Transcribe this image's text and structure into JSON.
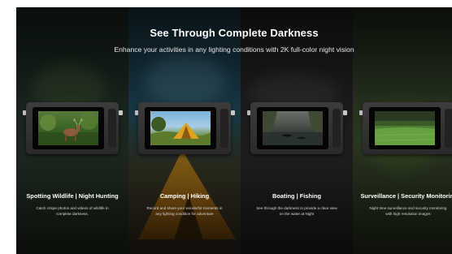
{
  "banner": {
    "headline": "See Through Complete Darkness",
    "subheadline": "Enhance your activities in any lighting conditions with 2K full-color night vision"
  },
  "features": [
    {
      "title": "Spotting Wildlife | Night Hunting",
      "description": "Catch crispe photos and videos of wildlife in complete darkness.",
      "screen_icon": "deer-in-forest-image"
    },
    {
      "title": "Camping | Hiking",
      "description": "Record and share your wonderful moments in any lighting condition for adventure",
      "screen_icon": "tent-in-field-image"
    },
    {
      "title": "Boating | Fishing",
      "description": "See through the darkness to provide a clear view on the water at Night",
      "screen_icon": "boats-on-river-image"
    },
    {
      "title": "Surveillance | Security Monitoring",
      "description": "Night time surveillance and security monitoring with high resolution images",
      "screen_icon": "field-landscape-image"
    }
  ],
  "colors": {
    "heading": "#ffffff",
    "body_text": "#d8d8d8",
    "device_body": "#2a2a2c"
  }
}
